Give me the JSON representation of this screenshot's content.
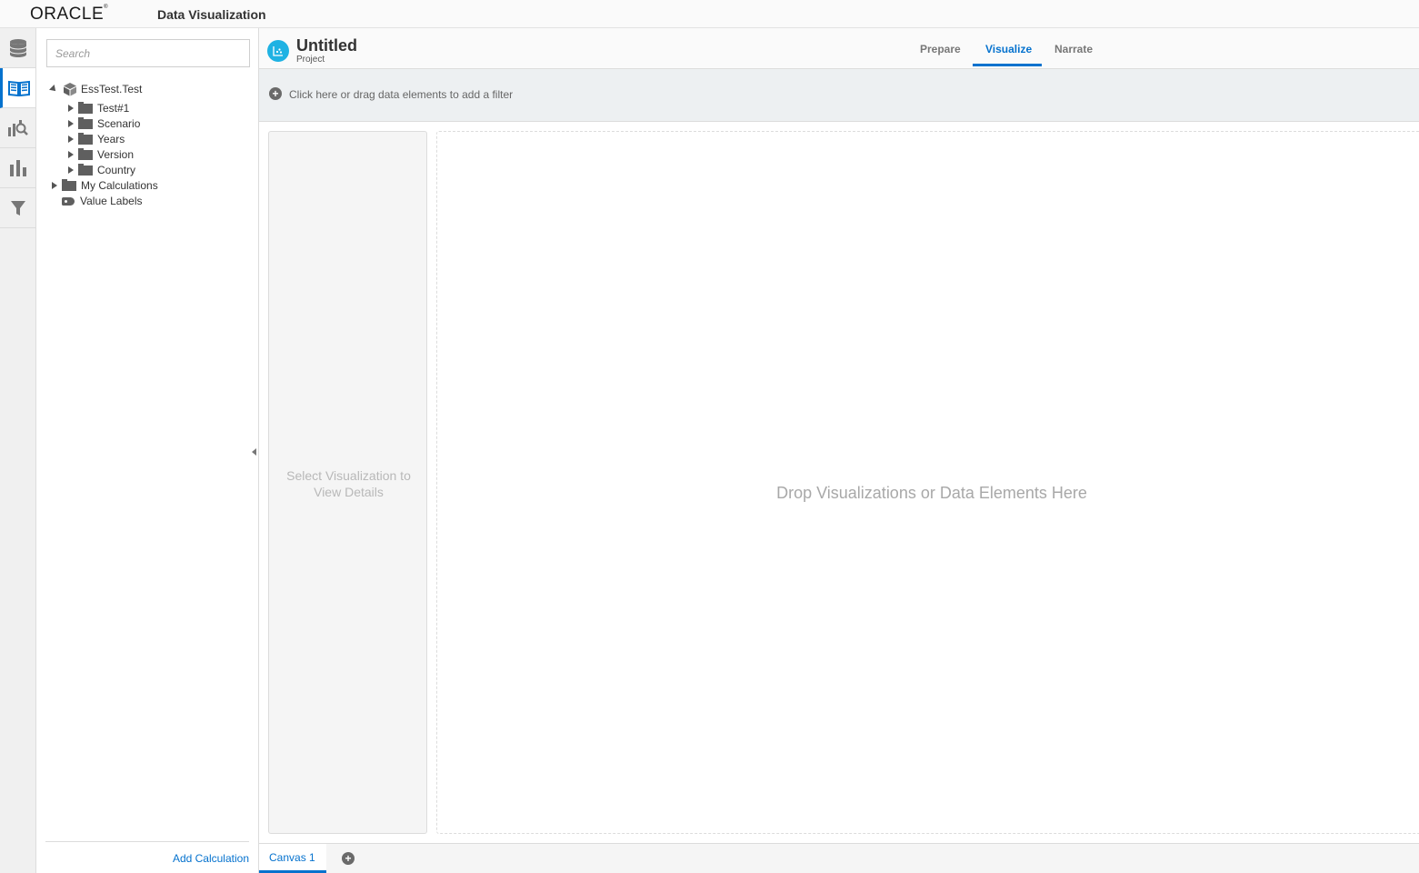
{
  "header": {
    "logo_text": "ORACLE",
    "app_title": "Data Visualization"
  },
  "rail": {
    "items": [
      "data-sources-icon",
      "data-elements-icon",
      "analytics-icon",
      "visualizations-icon",
      "filter-icon"
    ],
    "active_index": 1
  },
  "data_panel": {
    "search_placeholder": "Search",
    "tree": {
      "root": "EssTest.Test",
      "children": [
        "Test#1",
        "Scenario",
        "Years",
        "Version",
        "Country"
      ],
      "my_calculations": "My Calculations",
      "value_labels": "Value Labels"
    },
    "add_calculation": "Add Calculation"
  },
  "project": {
    "title": "Untitled",
    "subtitle": "Project",
    "tabs": [
      "Prepare",
      "Visualize",
      "Narrate"
    ],
    "active_tab": "Visualize"
  },
  "filter_bar": {
    "text": "Click here or drag data elements to add a filter"
  },
  "canvas": {
    "details_text": "Select Visualization to View Details",
    "drop_text": "Drop Visualizations or Data Elements Here",
    "tabs": [
      "Canvas 1"
    ]
  },
  "colors": {
    "accent": "#0572ce",
    "project_icon": "#1fb2e3"
  }
}
